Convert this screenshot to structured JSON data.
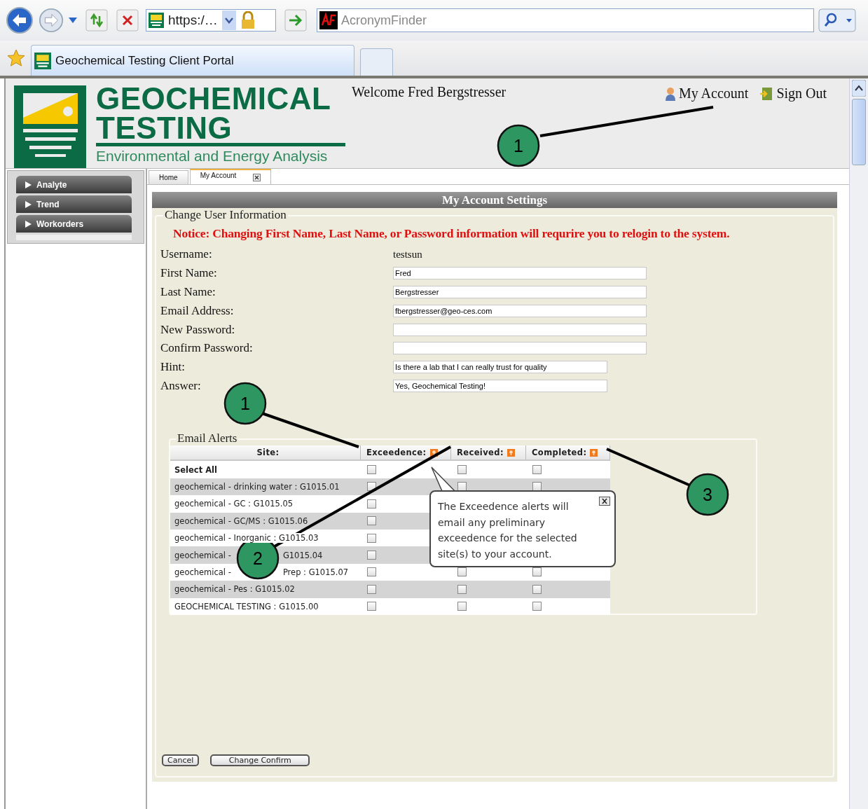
{
  "browser": {
    "address": "https:/…",
    "search_placeholder": "AcronymFinder",
    "tab_title": "Geochemical Testing Client Portal"
  },
  "header": {
    "brand_line1": "GEOCHEMICAL",
    "brand_line2": "TESTING",
    "tagline": "Environmental and Energy Analysis",
    "welcome": "Welcome Fred Bergstresser",
    "links": [
      {
        "label": "My Account",
        "kind": "account"
      },
      {
        "label": "Sign Out",
        "kind": "signout"
      }
    ]
  },
  "sidebar": {
    "items": [
      {
        "label": "Analyte"
      },
      {
        "label": "Trend"
      },
      {
        "label": "Workorders"
      }
    ]
  },
  "tabs": [
    {
      "label": "Home",
      "selected": false,
      "closable": false
    },
    {
      "label": "My Account",
      "selected": true,
      "closable": true
    }
  ],
  "panel": {
    "title": "My Account Settings",
    "section": "Change User Information",
    "notice": "Notice: Changing First Name, Last Name, or Password information will requrire you to relogin to the system.",
    "fields": [
      {
        "label": "Username:",
        "kind": "text",
        "value": "testsun"
      },
      {
        "label": "First Name:",
        "kind": "input",
        "value": "Fred"
      },
      {
        "label": "Last Name:",
        "kind": "input",
        "value": "Bergstresser"
      },
      {
        "label": "Email Address:",
        "kind": "input",
        "value": "fbergstresser@geo-ces.com"
      },
      {
        "label": "New Password:",
        "kind": "input"
      },
      {
        "label": "Confirm Password:",
        "kind": "input"
      },
      {
        "label": "Hint:",
        "kind": "short-input",
        "value": "Is there a lab that I can really trust for quality"
      },
      {
        "label": "Answer:",
        "kind": "short-input",
        "value": "Yes, Geochemical Testing!"
      }
    ],
    "alerts": {
      "legend": "Email Alerts",
      "columns": [
        {
          "label": "Site:",
          "help": false
        },
        {
          "label": "Exceedence:",
          "help": true
        },
        {
          "label": "Received:",
          "help": true
        },
        {
          "label": "Completed:",
          "help": true
        }
      ],
      "rows": [
        {
          "kind": "all",
          "site": [
            "Select All"
          ],
          "exceedence": {
            "checked": false
          },
          "received": {
            "checked": false
          },
          "completed": {
            "checked": false
          }
        },
        {
          "kind": "site",
          "site": [
            "geochemical - drinking water : G1015.01"
          ],
          "exceedence": {
            "checked": false
          },
          "received": {
            "checked": false
          },
          "completed": {
            "checked": false
          }
        },
        {
          "kind": "site",
          "site": [
            "geochemical - GC : G1015.05"
          ],
          "exceedence": {
            "checked": false
          }
        },
        {
          "kind": "site",
          "site": [
            "geochemical - GC/MS : G1015.06"
          ],
          "exceedence": {
            "checked": false
          }
        },
        {
          "kind": "site",
          "site": [
            "geochemical - Inorganic : G1015.03"
          ],
          "exceedence": {
            "checked": false
          }
        },
        {
          "kind": "site",
          "site": [
            "geochemical -",
            "G1015.04"
          ],
          "exceedence": {
            "checked": false
          }
        },
        {
          "kind": "site",
          "site": [
            "geochemical -",
            "Prep : G1015.07"
          ],
          "exceedence": {
            "checked": false
          },
          "received": {
            "checked": false
          },
          "completed": {
            "checked": false
          }
        },
        {
          "kind": "site",
          "site": [
            "geochemical - Pes : G1015.02"
          ],
          "exceedence": {
            "checked": false
          },
          "received": {
            "checked": false
          },
          "completed": {
            "checked": false
          }
        },
        {
          "kind": "site",
          "site": [
            "GEOCHEMICAL TESTING : G1015.00"
          ],
          "exceedence": {
            "checked": false
          },
          "received": {
            "checked": false
          },
          "completed": {
            "checked": false
          }
        }
      ],
      "tooltip": "The Exceedence alerts will email any preliminary exceedence for the selected site(s) to your account."
    },
    "buttons": [
      "Cancel",
      "Change Confirm"
    ]
  },
  "callouts": [
    {
      "number": "1"
    },
    {
      "number": "1"
    },
    {
      "number": "2"
    },
    {
      "number": "3"
    }
  ]
}
